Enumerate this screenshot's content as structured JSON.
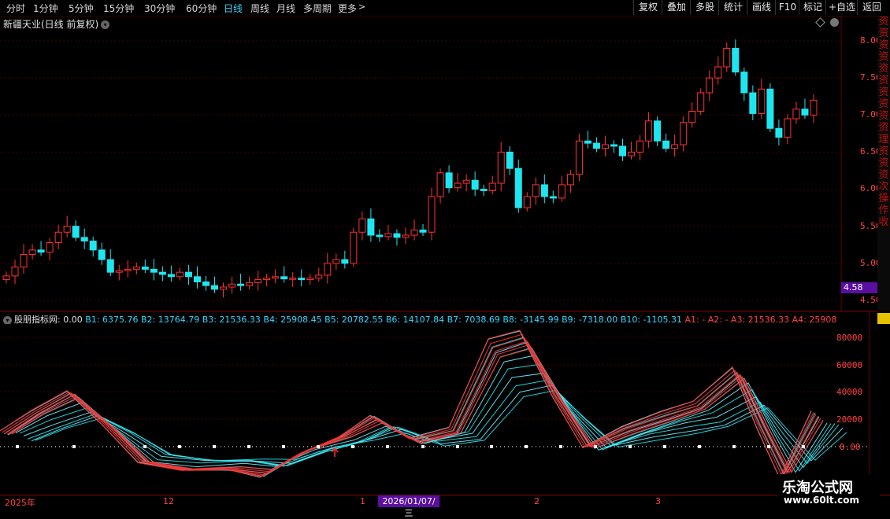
{
  "toolbar": {
    "periods": [
      {
        "label": "分时"
      },
      {
        "label": "1分钟"
      },
      {
        "label": "5分钟"
      },
      {
        "label": "15分钟"
      },
      {
        "label": "30分钟"
      },
      {
        "label": "60分钟"
      },
      {
        "label": "日线"
      },
      {
        "label": "周线"
      },
      {
        "label": "月线"
      },
      {
        "label": "多周期"
      },
      {
        "label": "更多"
      }
    ],
    "active": "日线",
    "right_buttons": [
      {
        "label": "复权"
      },
      {
        "label": "叠加"
      },
      {
        "label": "多股"
      },
      {
        "label": "统计"
      },
      {
        "label": "画线"
      },
      {
        "label": "F10"
      },
      {
        "label": "标记"
      },
      {
        "label": "+自选"
      },
      {
        "label": "返回"
      }
    ]
  },
  "stock_title": "新疆天业(日线 前复权)",
  "price_axis": [
    "8.00",
    "7.50",
    "7.00",
    "6.50",
    "6.00",
    "5.50",
    "5.00",
    "4.50"
  ],
  "current_price": "4.58",
  "indicator": {
    "name": "股朋指标网",
    "value": ": 0.00",
    "b_values": [
      "B1: 6375.76",
      "B2: 13764.79",
      "B3: 21536.33",
      "B4: 25908.45",
      "B5: 20782.55",
      "B6: 14107.84",
      "B7: 7038.69",
      "B8: -3145.99",
      "B9: -7318.00",
      "B10: -1105.31"
    ],
    "a_values": [
      "A1: -",
      "A2: -",
      "A3: 21536.33",
      "A4: 25908"
    ],
    "axis": [
      "80000",
      "60000",
      "40000",
      "20000",
      "0.00"
    ]
  },
  "dates": {
    "year": "2025年",
    "m12": "12",
    "m1": "1",
    "highlight": "2026/01/07/三",
    "m2": "2",
    "m3": "3"
  },
  "watermark": {
    "line1": "乐淘公式网",
    "line2": "www.60lt.com"
  },
  "side_text": "资资资资资资资资资资理资资资次操作收",
  "colors": {
    "up": "#ff3333",
    "down": "#1ee6f0",
    "bg": "#000000",
    "accent": "#5a0fa0"
  }
}
